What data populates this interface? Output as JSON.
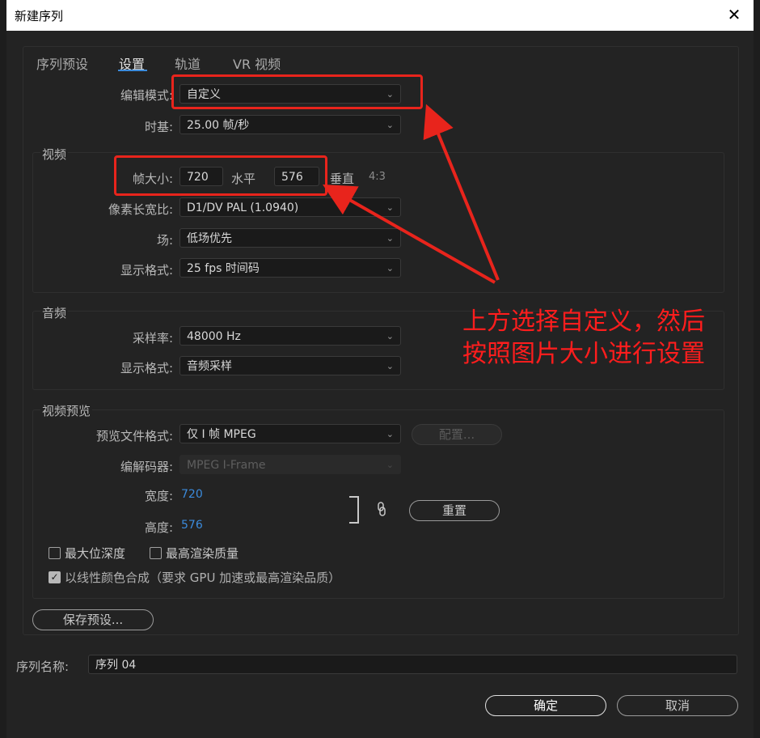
{
  "window": {
    "title": "新建序列",
    "close": "✕"
  },
  "tabs": [
    {
      "label": "序列预设"
    },
    {
      "label": "设置"
    },
    {
      "label": "轨道"
    },
    {
      "label": "VR 视频"
    }
  ],
  "editing_mode": {
    "label": "编辑模式:",
    "value": "自定义"
  },
  "timebase": {
    "label": "时基:",
    "value": "25.00  帧/秒"
  },
  "video": {
    "title": "视频",
    "frame_size_label": "帧大小:",
    "width": "720",
    "horizontal_label": "水平",
    "height": "576",
    "vertical_label": "垂直",
    "aspect": "4:3",
    "pixel_aspect_label": "像素长宽比:",
    "pixel_aspect_value": "D1/DV PAL (1.0940)",
    "fields_label": "场:",
    "fields_value": "低场优先",
    "display_format_label": "显示格式:",
    "display_format_value": "25 fps 时间码"
  },
  "audio": {
    "title": "音频",
    "sample_rate_label": "采样率:",
    "sample_rate_value": "48000 Hz",
    "display_format_label": "显示格式:",
    "display_format_value": "音频采样"
  },
  "video_preview": {
    "title": "视频预览",
    "file_format_label": "预览文件格式:",
    "file_format_value": "仅 I 帧 MPEG",
    "configure_label": "配置...",
    "codec_label": "编解码器:",
    "codec_value": "MPEG I-Frame",
    "width_label": "宽度:",
    "width_value": "720",
    "height_label": "高度:",
    "height_value": "576",
    "reset_label": "重置",
    "max_bit_depth": "最大位深度",
    "max_render_quality": "最高渲染质量",
    "linear_color": "以线性颜色合成（要求 GPU 加速或最高渲染品质）"
  },
  "save_preset_label": "保存预设...",
  "sequence_name": {
    "label": "序列名称:",
    "value": "序列 04"
  },
  "ok_label": "确定",
  "cancel_label": "取消",
  "annotation": {
    "line1": "上方选择自定义，然后",
    "line2": "按照图片大小进行设置",
    "color": "#ff1d1d"
  },
  "icons": {
    "dropdown": "chevron-down-icon",
    "link": "link-icon",
    "check": "checkmark-icon"
  }
}
